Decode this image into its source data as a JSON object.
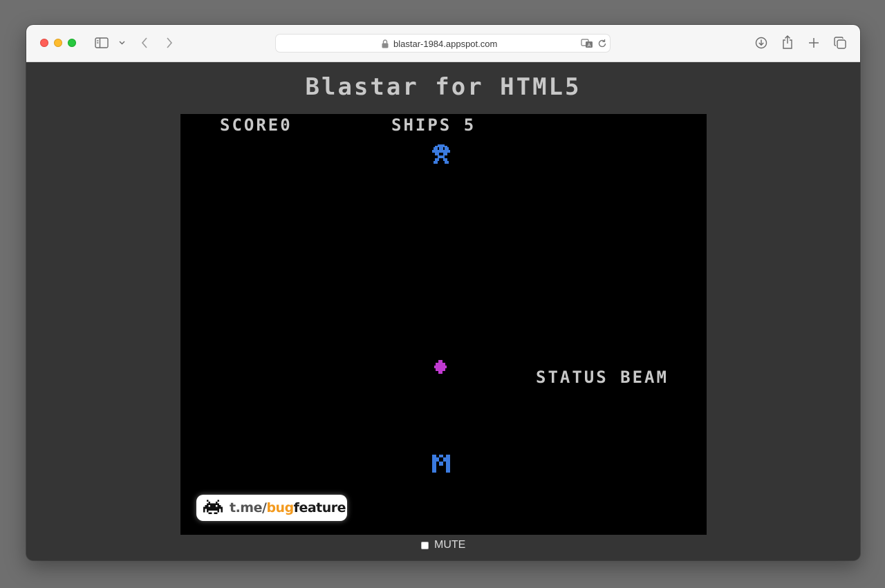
{
  "browser": {
    "url": "blastar-1984.appspot.com",
    "icons": [
      "sidebar-icon",
      "chevron-down-icon",
      "back-icon",
      "forward-icon",
      "lock-icon",
      "translate-icon",
      "reload-icon",
      "download-icon",
      "share-icon",
      "new-tab-icon",
      "tabs-overview-icon"
    ]
  },
  "page": {
    "title": "Blastar for HTML5"
  },
  "game": {
    "score_label": "SCORE",
    "score_value": "0",
    "ships_label": "SHIPS",
    "ships_value": "5",
    "status_text": "STATUS BEAM",
    "colors": {
      "background": "#000000",
      "hud_text": "#c8c8c8",
      "enemy": "#3b7be0",
      "player": "#3b7be0",
      "status_beam": "#c03ad0"
    },
    "sprites": [
      "enemy-ship",
      "status-beam-projectile",
      "player-ship"
    ]
  },
  "watermark": {
    "prefix": "t.me/",
    "accent": "bug",
    "suffix": "feature",
    "icon": "space-invader-icon"
  },
  "controls": {
    "mute_label": "MUTE",
    "mute_checked": false
  }
}
